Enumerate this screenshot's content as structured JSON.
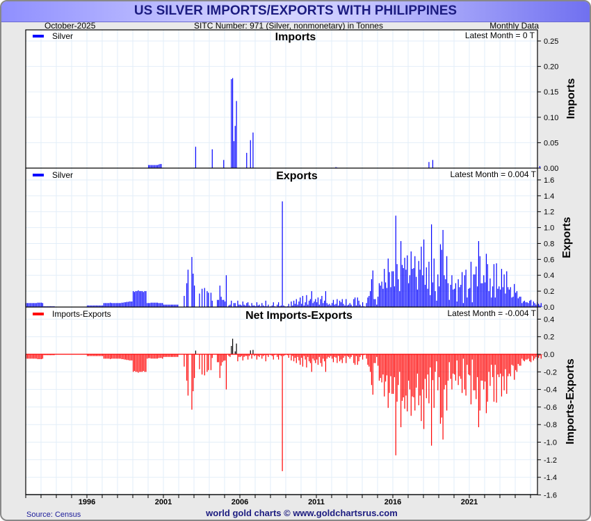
{
  "header": {
    "title": "US SILVER IMPORTS/EXPORTS WITH PHILIPPINES",
    "date": "October-2025",
    "subtitle": "SITC Number: 971 (Silver, nonmonetary) in Tonnes",
    "frequency": "Monthly Data"
  },
  "footer": {
    "source": "Source: Census",
    "credit": "world gold charts © www.goldchartsrus.com"
  },
  "colors": {
    "imports": "#0000ff",
    "exports": "#0000ff",
    "net_negative": "#ff0000",
    "net_positive": "#000000",
    "title": "#1c1c80"
  },
  "chart_data": [
    {
      "type": "bar",
      "title": "Imports",
      "ylabel": "Imports",
      "legend": "Silver",
      "legend_position": "top-left",
      "latest": "Latest Month = 0 T",
      "ylim": [
        0,
        0.27
      ],
      "yticks": [
        "0.00",
        "0.05",
        "0.10",
        "0.15",
        "0.20",
        "0.25"
      ],
      "points": [
        [
          "2000-01",
          0.006
        ],
        [
          "2000-02",
          0.006
        ],
        [
          "2000-03",
          0.006
        ],
        [
          "2000-04",
          0.006
        ],
        [
          "2000-05",
          0.006
        ],
        [
          "2000-06",
          0.006
        ],
        [
          "2000-07",
          0.006
        ],
        [
          "2000-08",
          0.006
        ],
        [
          "2000-09",
          0.007
        ],
        [
          "2000-10",
          0.008
        ],
        [
          "2000-11",
          0.008
        ],
        [
          "2003-02",
          0.042
        ],
        [
          "2004-03",
          0.037
        ],
        [
          "2004-12",
          0.016
        ],
        [
          "2005-06",
          0.175
        ],
        [
          "2005-07",
          0.177
        ],
        [
          "2005-08",
          0.053
        ],
        [
          "2005-09",
          0.083
        ],
        [
          "2005-10",
          0.132
        ],
        [
          "2006-06",
          0.03
        ],
        [
          "2006-09",
          0.055
        ],
        [
          "2006-11",
          0.07
        ],
        [
          "2012-04",
          0.002
        ],
        [
          "2012-05",
          0.001
        ],
        [
          "2018-05",
          0.012
        ],
        [
          "2018-08",
          0.016
        ],
        [
          "2025-08",
          0.004
        ]
      ]
    },
    {
      "type": "bar",
      "title": "Exports",
      "ylabel": "Exports",
      "legend": "Silver",
      "legend_position": "top-left",
      "latest": "Latest Month = 0.004 T",
      "ylim": [
        0,
        1.75
      ],
      "yticks": [
        "0.0",
        "0.2",
        "0.4",
        "0.6",
        "0.8",
        "1.0",
        "1.2",
        "1.4",
        "1.6"
      ],
      "start": "1992-01",
      "monthly": {
        "1992": [
          0.05,
          0.05,
          0.05,
          0.05,
          0.05,
          0.05,
          0.05,
          0.05,
          0.05,
          0.055,
          0.055,
          0.055
        ],
        "1993": [
          0.055,
          0.05,
          0.01,
          0.01,
          0.01,
          0.01,
          0.01,
          0.01,
          0.01,
          0.01,
          0.01,
          0
        ],
        "1994": [
          0,
          0,
          0,
          0,
          0,
          0,
          0,
          0,
          0,
          0,
          0,
          0
        ],
        "1995": [
          0,
          0,
          0,
          0,
          0,
          0,
          0,
          0,
          0,
          0,
          0,
          0
        ],
        "1996": [
          0.02,
          0.02,
          0.02,
          0.02,
          0.02,
          0.02,
          0.02,
          0.02,
          0.02,
          0.02,
          0.02,
          0.02
        ],
        "1997": [
          0.02,
          0.05,
          0.05,
          0.05,
          0.05,
          0.05,
          0.055,
          0.05,
          0.05,
          0.05,
          0.05,
          0.05
        ],
        "1998": [
          0.05,
          0.05,
          0.05,
          0.055,
          0.055,
          0.06,
          0.06,
          0.065,
          0.065,
          0.07,
          0.07,
          0.07
        ],
        "1999": [
          0.2,
          0.19,
          0.2,
          0.2,
          0.21,
          0.2,
          0.2,
          0.2,
          0.19,
          0.2,
          0.2,
          0.05
        ],
        "2000": [
          0.05,
          0.05,
          0.055,
          0.055,
          0.055,
          0.055,
          0.055,
          0.055,
          0.05,
          0.05,
          0.05,
          0.05
        ],
        "2001": [
          0.03,
          0.03,
          0.03,
          0.03,
          0.03,
          0.03,
          0.03,
          0.03,
          0.03,
          0.03,
          0.03,
          0.03
        ],
        "2002": [
          0,
          0,
          0,
          0,
          0.14,
          0,
          0.3,
          0.47,
          0,
          0,
          0.63,
          0.42
        ],
        "2003": [
          0.27,
          0,
          0,
          0,
          0.17,
          0,
          0.23,
          0,
          0.24,
          0,
          0.2,
          0.18
        ],
        "2004": [
          0,
          0.18,
          0.08,
          0,
          0,
          0,
          0.09,
          0.09,
          0.27,
          0.13,
          0.09,
          0.09
        ],
        "2005": [
          0.07,
          0.4,
          0,
          0.02,
          0.03,
          0.08,
          0,
          0.05,
          0.05,
          0.01,
          0.08,
          0.03
        ],
        "2006": [
          0.03,
          0.02,
          0.07,
          0.03,
          0.02,
          0.05,
          0.06,
          0.02,
          0.01,
          0.05,
          0.02,
          0.02
        ],
        "2007": [
          0.01,
          0.06,
          0.02,
          0.03,
          0.01,
          0.05,
          0.02,
          0.01,
          0.08,
          0.01,
          0.03,
          0
        ],
        "2008": [
          0.01,
          0.02,
          0.06,
          0.01,
          0,
          0.03,
          0.06,
          0.01,
          0.02,
          1.33,
          0.02,
          0.01
        ],
        "2009": [
          0,
          0.01,
          0.04,
          0,
          0.07,
          0.02,
          0.08,
          0.04,
          0.1,
          0.03,
          0.07,
          0.12
        ],
        "2010": [
          0.04,
          0.14,
          0.02,
          0.06,
          0.15,
          0.03,
          0.08,
          0.1,
          0.2,
          0.05,
          0.07,
          0.1
        ],
        "2011": [
          0.06,
          0.12,
          0.03,
          0.1,
          0.14,
          0.05,
          0.08,
          0.2,
          0.05,
          0.03,
          0.04,
          0.02
        ],
        "2012": [
          0.05,
          0.09,
          0.03,
          0.04,
          0.1,
          0.02,
          0.08,
          0.06,
          0.1,
          0.04,
          0.02,
          0.1
        ],
        "2013": [
          0.02,
          0.03,
          0.05,
          0.03,
          0.01,
          0.1,
          0.12,
          0.02,
          0.12,
          0.08,
          0.03,
          0.01
        ],
        "2014": [
          0.06,
          0.01,
          0,
          0.05,
          0.12,
          0.14,
          0.2,
          0.35,
          0.46,
          0.1,
          0.1,
          0.03
        ],
        "2015": [
          0.13,
          0.3,
          0.27,
          0.32,
          0.23,
          0.48,
          0.31,
          0.24,
          0.61,
          0.44,
          0.25,
          0.45
        ],
        "2016": [
          0.45,
          0.26,
          1.15,
          0.54,
          0.35,
          0.2,
          0.83,
          0.53,
          0.49,
          0.62,
          0.47,
          0.65
        ],
        "2017": [
          0.3,
          0.4,
          0.7,
          0.48,
          0.49,
          0.64,
          0.38,
          0.22,
          0.58,
          0.47,
          0.76,
          0.4
        ],
        "2018": [
          0.85,
          0.28,
          0.5,
          0.23,
          0.57,
          0.15,
          1.04,
          0.31,
          0.61,
          0.2,
          0.08,
          0.41
        ],
        "2019": [
          0.26,
          0.79,
          0.72,
          0.97,
          0.4,
          0.35,
          0.64,
          0.3,
          0.09,
          0.28,
          0.4,
          0.22
        ],
        "2020": [
          0.23,
          0.3,
          0.07,
          0.35,
          0.25,
          0.28,
          0.44,
          0.05,
          0.4,
          0.47,
          0.12,
          0.23
        ],
        "2021": [
          0.24,
          0.57,
          0.06,
          0.41,
          0.41,
          0.51,
          0.26,
          0.83,
          0.64,
          0.3,
          0.3,
          0.4
        ],
        "2022": [
          0.31,
          0.67,
          0.54,
          0.2,
          0.36,
          0.12,
          0.26,
          0.54,
          0.12,
          0.55,
          0.23,
          0.26
        ],
        "2023": [
          0.22,
          0.48,
          0.25,
          0.41,
          0.17,
          0.45,
          0.25,
          0.22,
          0.25,
          0.12,
          0.13,
          0.29
        ],
        "2024": [
          0.18,
          0.2,
          0.11,
          0.13,
          0.13,
          0.05,
          0.07,
          0.08,
          0.06,
          0.06,
          0.05,
          0.08
        ],
        "2025": [
          0.09,
          0.02,
          0.07,
          0.05,
          0.03,
          0.06,
          0.04,
          0.02,
          0.05,
          0.004
        ]
      }
    },
    {
      "type": "bar",
      "title": "Net Imports-Exports",
      "ylabel": "Imports-Exports",
      "legend": "Imports-Exports",
      "legend_position": "top-left",
      "latest": "Latest Month = -0.004 T",
      "derived": "imports minus exports",
      "ylim": [
        -1.6,
        0.45
      ],
      "yticks": [
        "-1.6",
        "-1.4",
        "-1.2",
        "-1.0",
        "-0.8",
        "-0.6",
        "-0.4",
        "-0.2",
        "0.0",
        "0.2",
        "0.4"
      ]
    }
  ],
  "xaxis": {
    "range": [
      1992,
      2025.9
    ],
    "labels": [
      "1996",
      "2001",
      "2006",
      "2011",
      "2016",
      "2021"
    ]
  }
}
